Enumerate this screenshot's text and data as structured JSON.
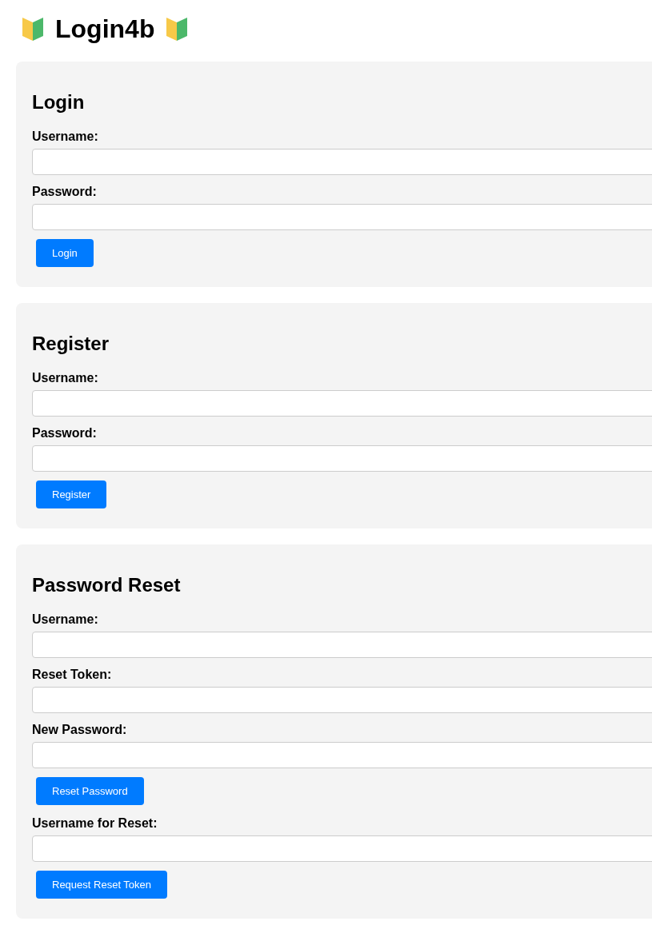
{
  "title": "Login4b",
  "panels": [
    {
      "heading": "Login",
      "items": [
        {
          "kind": "field",
          "label": "Username:"
        },
        {
          "kind": "field",
          "label": "Password:"
        },
        {
          "kind": "button",
          "label": "Login"
        }
      ]
    },
    {
      "heading": "Register",
      "items": [
        {
          "kind": "field",
          "label": "Username:"
        },
        {
          "kind": "field",
          "label": "Password:"
        },
        {
          "kind": "button",
          "label": "Register"
        }
      ]
    },
    {
      "heading": "Password Reset",
      "items": [
        {
          "kind": "field",
          "label": "Username:"
        },
        {
          "kind": "field",
          "label": "Reset Token:"
        },
        {
          "kind": "field",
          "label": "New Password:"
        },
        {
          "kind": "button",
          "label": "Reset Password"
        },
        {
          "kind": "field",
          "label": "Username for Reset:"
        },
        {
          "kind": "button",
          "label": "Request Reset Token"
        }
      ]
    }
  ]
}
